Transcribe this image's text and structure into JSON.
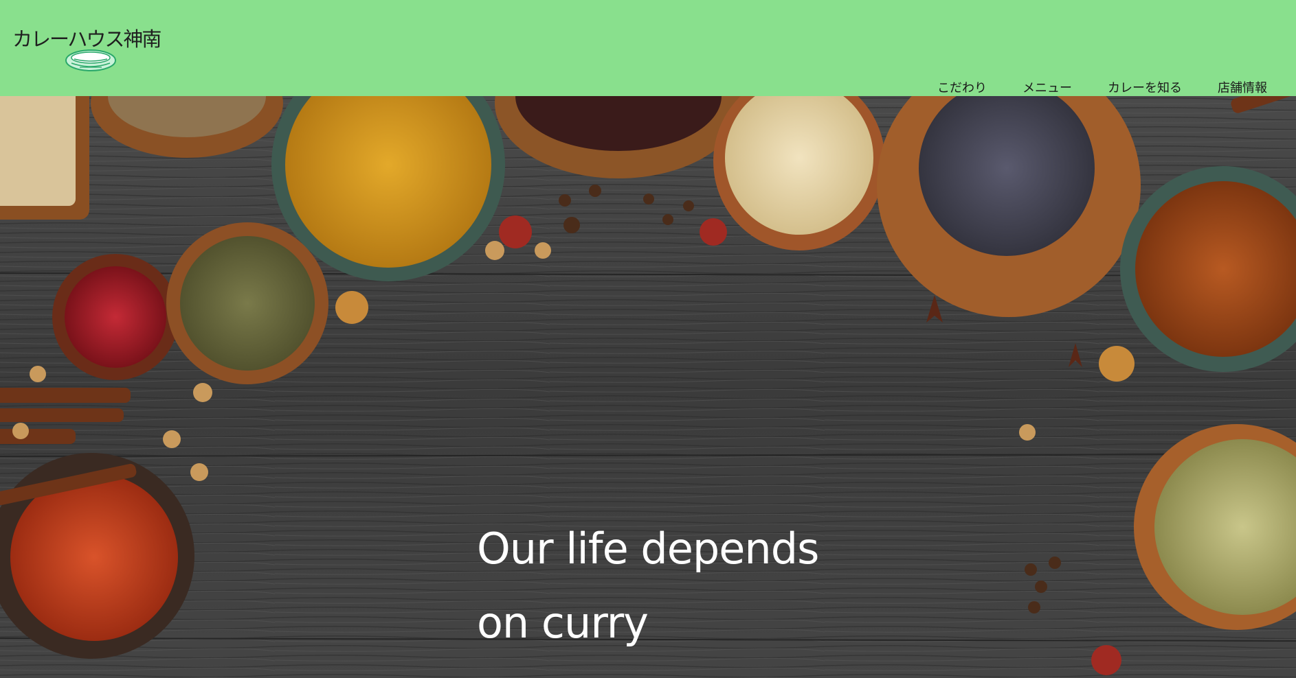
{
  "header": {
    "logo_text": "カレーハウス神南",
    "background_color": "#89e08d"
  },
  "nav": {
    "items": [
      "こだわり",
      "メニュー",
      "カレーを知る",
      "店舗情報"
    ]
  },
  "hero": {
    "tagline_line1": "Our life depends",
    "tagline_line2": "on curry",
    "image": "spices-on-wooden-table"
  }
}
